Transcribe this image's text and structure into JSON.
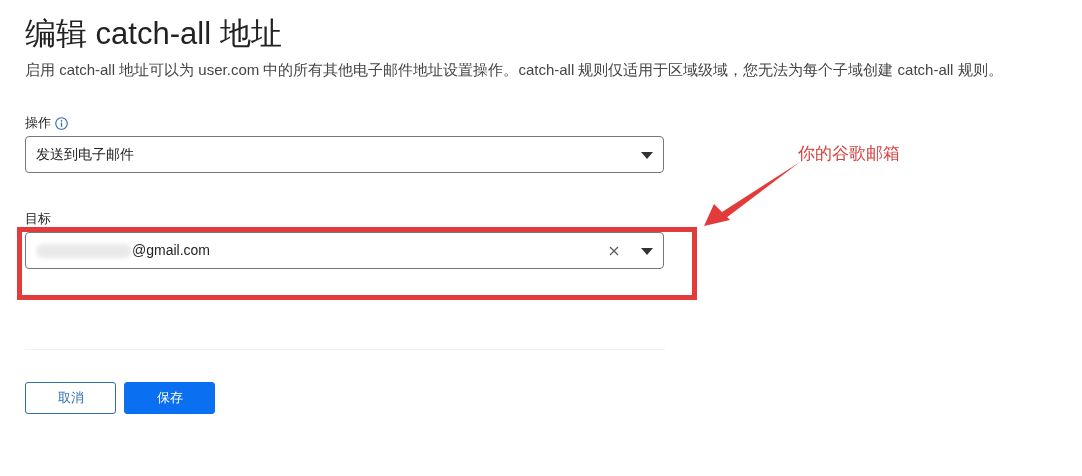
{
  "title": "编辑 catch-all 地址",
  "description": "启用 catch-all 地址可以为 user.com 中的所有其他电子邮件地址设置操作。catch-all 规则仅适用于区域级域，您无法为每个子域创建 catch-all 规则。",
  "action_field": {
    "label": "操作",
    "value": "发送到电子邮件"
  },
  "target_field": {
    "label": "目标",
    "value": "@gmail.com"
  },
  "buttons": [
    {
      "label": "取消",
      "kind": "secondary"
    },
    {
      "label": "保存",
      "kind": "primary"
    }
  ],
  "annotation": {
    "text": "你的谷歌邮箱"
  }
}
